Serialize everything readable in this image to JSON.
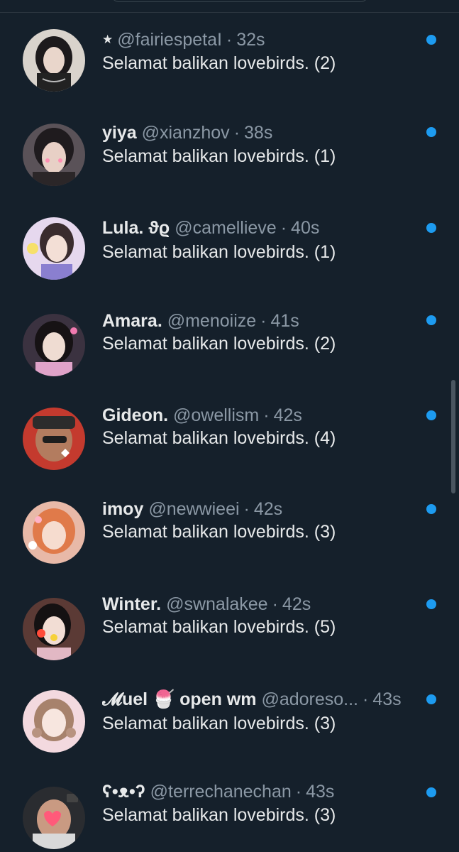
{
  "conversations": [
    {
      "display_name": "",
      "prefix_icon": "star-icon",
      "handle": "@fairiespetaI",
      "separator": "·",
      "time": "32s",
      "message": "Selamat balikan lovebirds. (2)",
      "unread": true
    },
    {
      "display_name": "yiya",
      "handle": "@xianzhov",
      "separator": "·",
      "time": "38s",
      "message": "Selamat balikan lovebirds. (1)",
      "unread": true
    },
    {
      "display_name": "Lula. ϑϱ",
      "handle": "@camellieve",
      "separator": "·",
      "time": "40s",
      "message": "Selamat balikan lovebirds. (1)",
      "unread": true
    },
    {
      "display_name": "Amara.",
      "handle": "@menoiize",
      "separator": "·",
      "time": "41s",
      "message": "Selamat balikan lovebirds. (2)",
      "unread": true
    },
    {
      "display_name": "Gideon.",
      "handle": "@owellism",
      "separator": "·",
      "time": "42s",
      "message": "Selamat balikan lovebirds. (4)",
      "unread": true
    },
    {
      "display_name": "imoy",
      "handle": "@newwieei",
      "separator": "·",
      "time": "42s",
      "message": "Selamat balikan lovebirds. (3)",
      "unread": true
    },
    {
      "display_name": "Winter.",
      "handle": "@swnalakee",
      "separator": "·",
      "time": "42s",
      "message": "Selamat balikan lovebirds. (5)",
      "unread": true
    },
    {
      "display_name": "𝓜uel 🍧 open wm",
      "handle": "@adoreso...",
      "separator": "·",
      "time": "43s",
      "message": "Selamat balikan lovebirds. (3)",
      "unread": true
    },
    {
      "display_name": "ʕ•ᴥ•ʔ",
      "handle": "@terrechanechan",
      "separator": "·",
      "time": "43s",
      "message": "Selamat balikan lovebirds. (3)",
      "unread": true
    }
  ],
  "colors": {
    "background": "#15202b",
    "primary_text": "#e7e9ea",
    "secondary_text": "#8b98a5",
    "unread_dot": "#1d9bf0"
  }
}
